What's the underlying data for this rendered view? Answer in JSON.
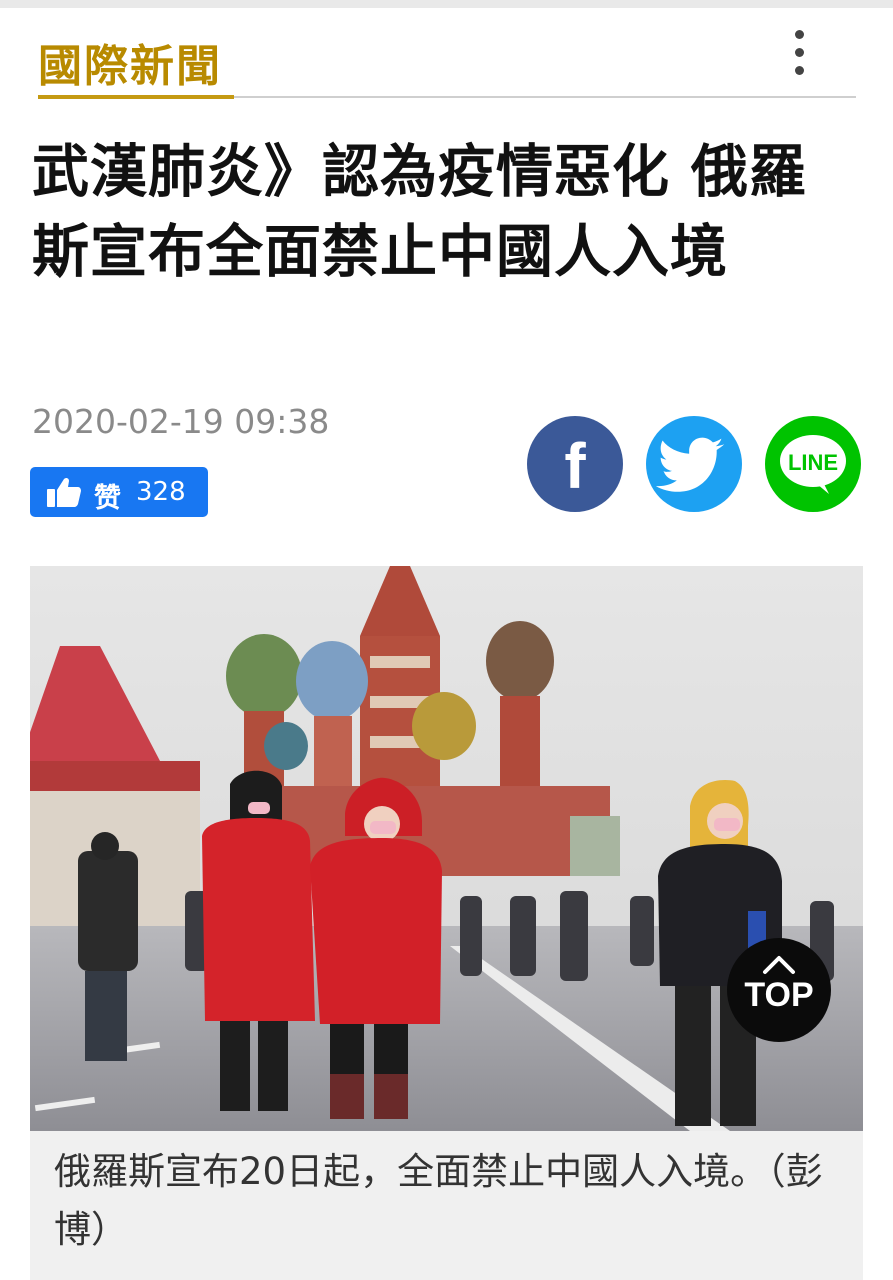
{
  "section": {
    "title": "國際新聞"
  },
  "article": {
    "headline": "武漢肺炎》認為疫情惡化 俄羅斯宣布全面禁止中國人入境",
    "timestamp": "2020-02-19 09:38",
    "like": {
      "label": "赞",
      "count": "328"
    },
    "caption": "俄羅斯宣布20日起，全面禁止中國人入境。（彭博）"
  },
  "share": {
    "facebook_glyph": "f",
    "line_glyph": "LINE"
  },
  "scroll_top": {
    "label": "TOP"
  },
  "colors": {
    "section_accent": "#c59a12",
    "like_blue": "#1877f2",
    "facebook": "#3b5998",
    "twitter": "#1da1f2",
    "line": "#00c300"
  },
  "icons": [
    "more-vertical-icon",
    "thumbs-up-icon",
    "facebook-icon",
    "twitter-bird-icon",
    "line-icon",
    "chevron-up-icon"
  ]
}
